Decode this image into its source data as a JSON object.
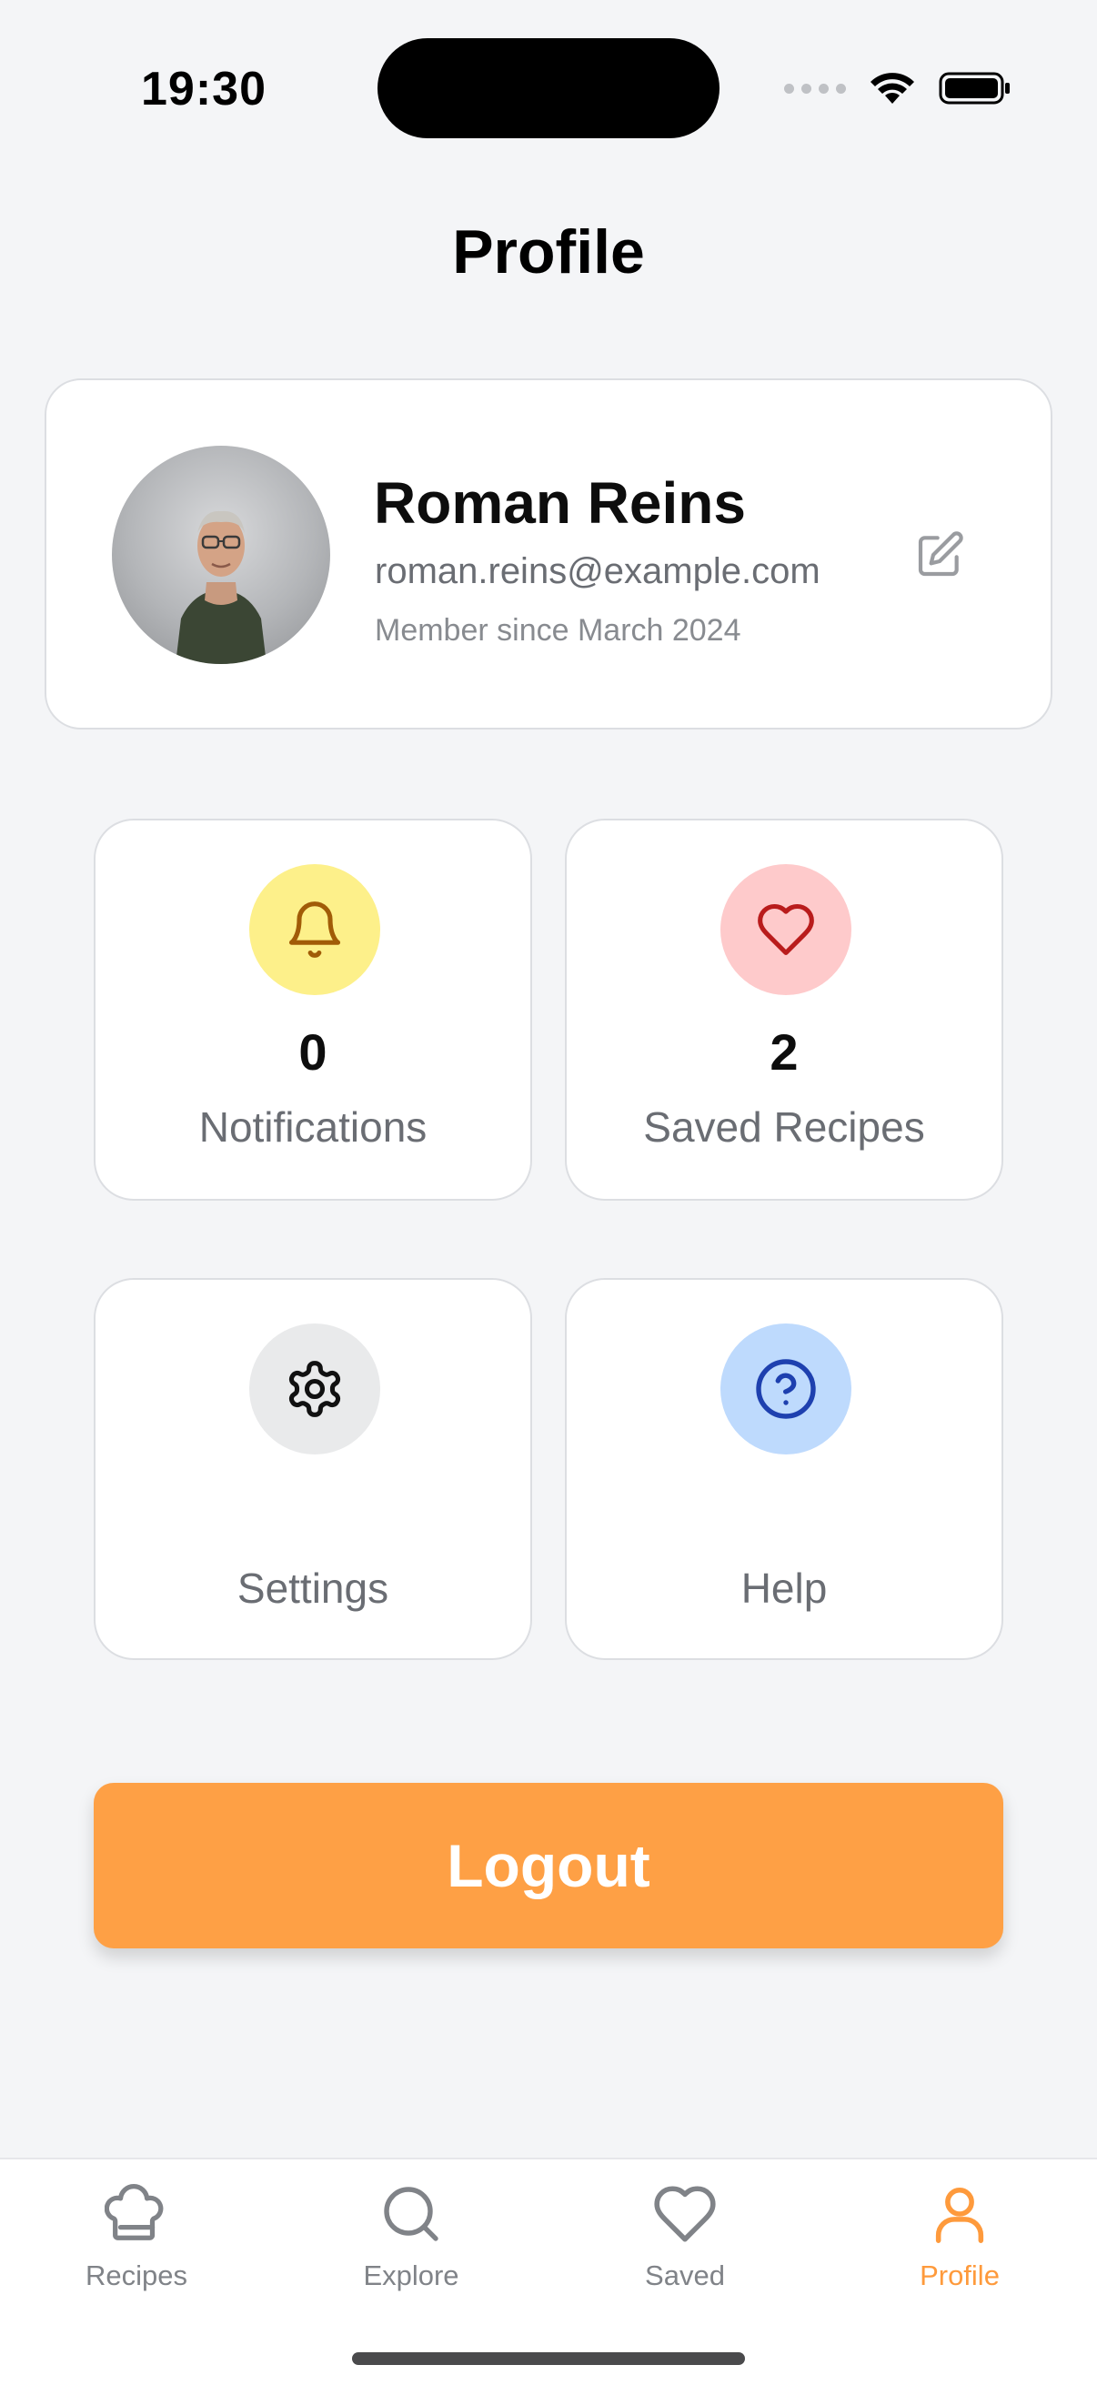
{
  "status_bar": {
    "time": "19:30"
  },
  "header": {
    "title": "Profile"
  },
  "profile": {
    "name": "Roman Reins",
    "email": "roman.reins@example.com",
    "member_since": "Member since March 2024"
  },
  "tiles": [
    {
      "icon": "bell-icon",
      "count": "0",
      "label": "Notifications",
      "color": "#fdf08a"
    },
    {
      "icon": "heart-icon",
      "count": "2",
      "label": "Saved Recipes",
      "color": "#fecacb"
    },
    {
      "icon": "gear-icon",
      "count": "",
      "label": "Settings",
      "color": "#e9eaeb"
    },
    {
      "icon": "help-icon",
      "count": "",
      "label": "Help",
      "color": "#bedafd"
    }
  ],
  "logout": {
    "label": "Logout",
    "color": "#fea045"
  },
  "bottom_nav": {
    "items": [
      {
        "icon": "chef-hat-icon",
        "label": "Recipes"
      },
      {
        "icon": "search-icon",
        "label": "Explore"
      },
      {
        "icon": "heart-icon",
        "label": "Saved"
      },
      {
        "icon": "user-icon",
        "label": "Profile",
        "active": true
      }
    ],
    "active_color": "#fe9a3c"
  }
}
